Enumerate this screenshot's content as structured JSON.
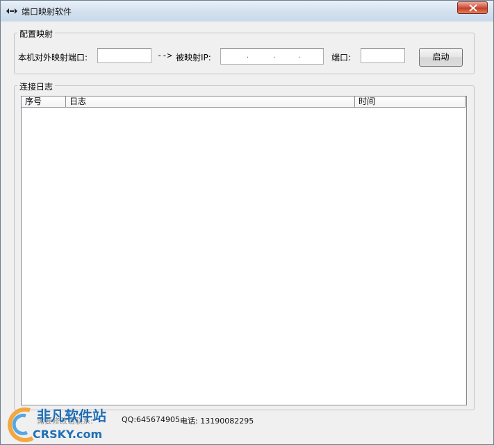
{
  "window": {
    "title": "端口映射软件"
  },
  "config": {
    "group_title": "配置映射",
    "local_port_label": "本机对外映射端口:",
    "local_port_value": "",
    "arrow": "-->",
    "target_ip_label": "被映射IP:",
    "target_ip_dots": [
      ".",
      ".",
      "."
    ],
    "port_label": "端口:",
    "port_value": "",
    "start_button": "启动"
  },
  "log": {
    "group_title": "连接日志",
    "columns": [
      "序号",
      "日志",
      "时间"
    ],
    "rows": []
  },
  "status": {
    "prefix": "需要修改请联系:",
    "qq": "QQ:645674905",
    "phone": "电话: 13190082295"
  },
  "watermark": {
    "line1": "非凡软件站",
    "line2": "CRSKY.com"
  },
  "colors": {
    "titlebar": "#d3e0ee",
    "close_button": "#c43c24",
    "watermark": "#1f6fb5"
  }
}
